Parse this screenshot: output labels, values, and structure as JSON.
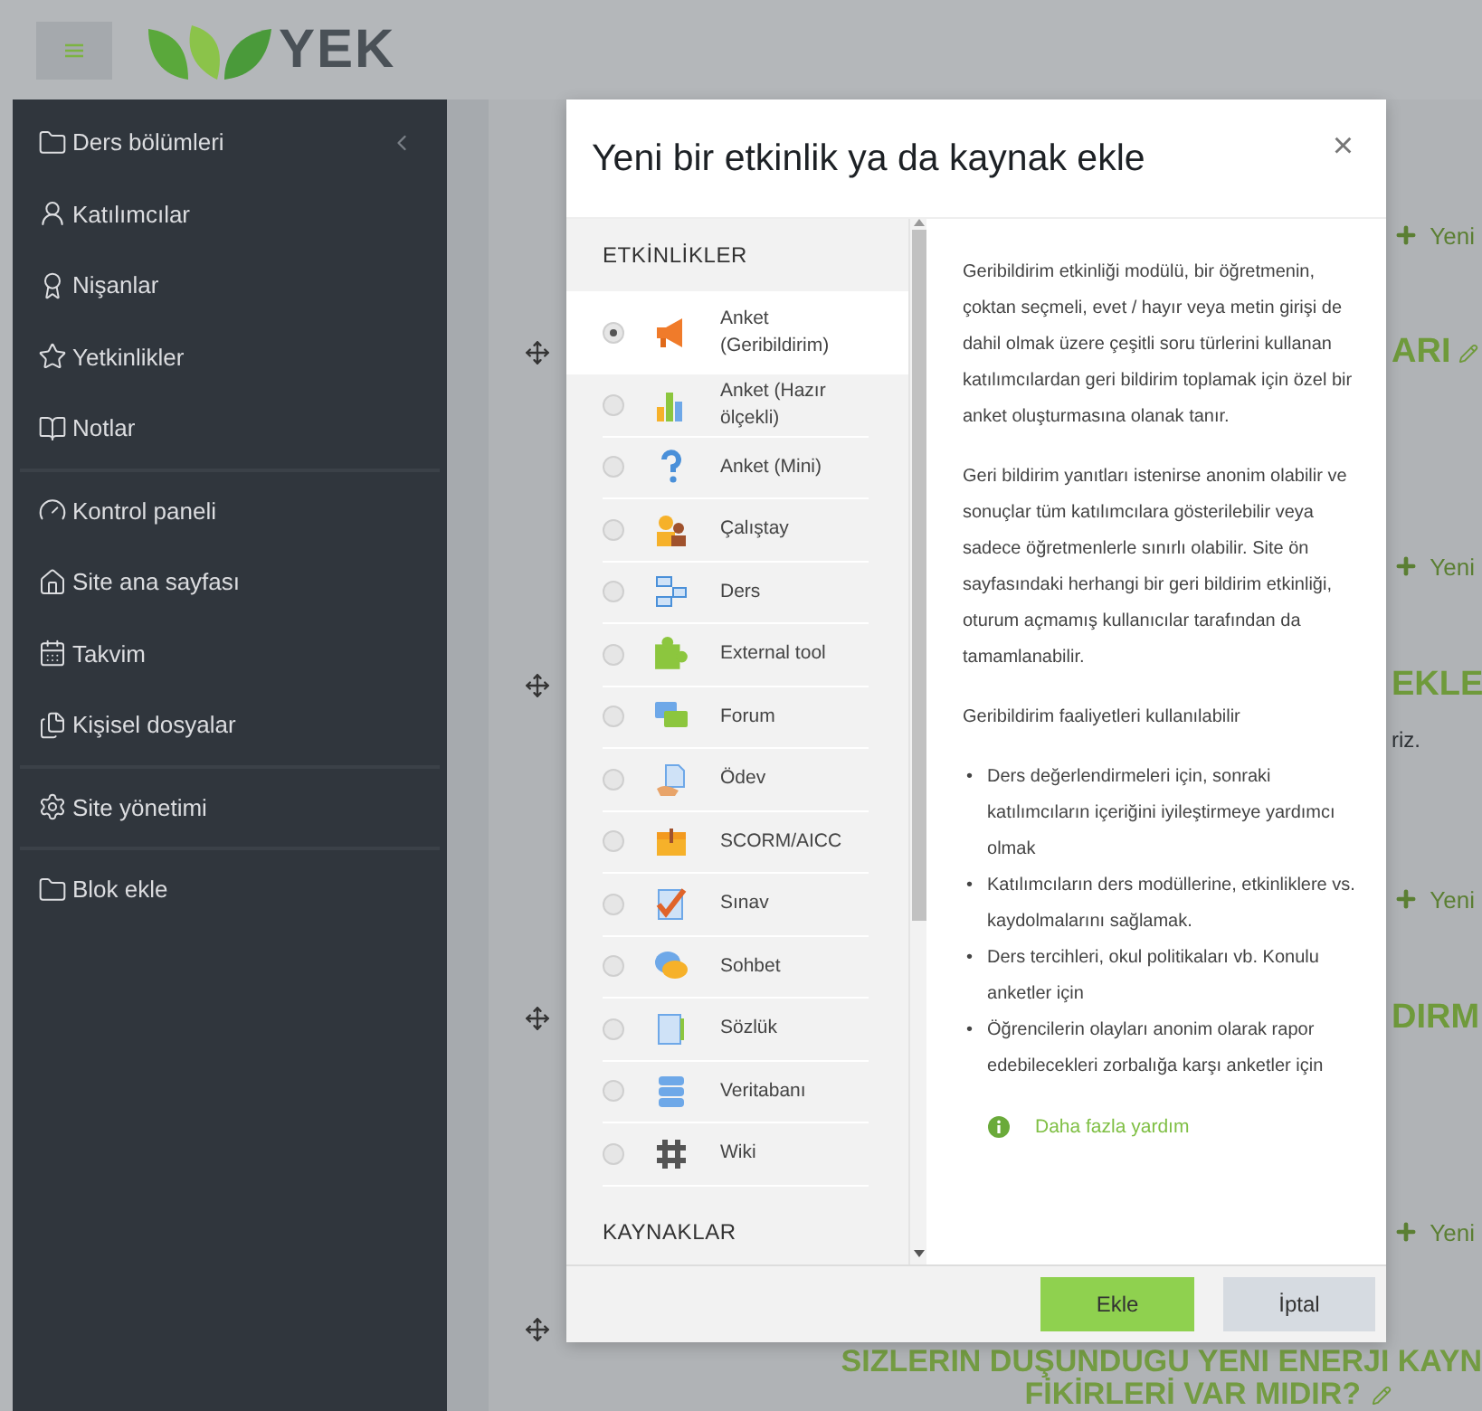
{
  "header": {
    "logo_text": "YEK"
  },
  "sidebar": {
    "groups": [
      [
        {
          "label": "Ders bölümleri",
          "collapsible": true
        },
        {
          "label": "Katılımcılar",
          "collapsible": false
        },
        {
          "label": "Nişanlar",
          "collapsible": false
        },
        {
          "label": "Yetkinlikler",
          "collapsible": false
        },
        {
          "label": "Notlar",
          "collapsible": false
        }
      ],
      [
        {
          "label": "Kontrol paneli",
          "collapsible": false
        },
        {
          "label": "Site ana sayfası",
          "collapsible": false
        },
        {
          "label": "Takvim",
          "collapsible": false
        },
        {
          "label": "Kişisel dosyalar",
          "collapsible": false
        }
      ],
      [
        {
          "label": "Site yönetimi",
          "collapsible": false
        }
      ],
      [
        {
          "label": "Blok ekle",
          "collapsible": false
        }
      ]
    ]
  },
  "course": {
    "sections": [
      {
        "kind": "add",
        "text": "Yeni"
      },
      {
        "kind": "heading",
        "text": "ARI",
        "editable": true
      },
      {
        "kind": "add",
        "text": "Yeni"
      },
      {
        "kind": "heading",
        "text": "EKLE"
      },
      {
        "kind": "text",
        "text": "riz."
      },
      {
        "kind": "add",
        "text": "Yeni"
      },
      {
        "kind": "heading",
        "text": "DIRM"
      },
      {
        "kind": "add",
        "text": "Yeni"
      },
      {
        "kind": "title",
        "lines": [
          "SIZLERIN DUŞUNDUGU YENI ENERJI KAYN",
          "FİKİRLERİ VAR MIDIR?"
        ]
      }
    ]
  },
  "dialog": {
    "title": "Yeni bir etkinlik ya da kaynak ekle",
    "close": "×",
    "activities_heading": "ETKİNLİKLER",
    "activities": [
      {
        "label": "Anket (Geribildirim)",
        "selected": true
      },
      {
        "label": "Anket (Hazır ölçekli)",
        "selected": false
      },
      {
        "label": "Anket (Mini)",
        "selected": false
      },
      {
        "label": "Çalıştay",
        "selected": false
      },
      {
        "label": "Ders",
        "selected": false
      },
      {
        "label": "External tool",
        "selected": false
      },
      {
        "label": "Forum",
        "selected": false
      },
      {
        "label": "Ödev",
        "selected": false
      },
      {
        "label": "SCORM/AICC",
        "selected": false
      },
      {
        "label": "Sınav",
        "selected": false
      },
      {
        "label": "Sohbet",
        "selected": false
      },
      {
        "label": "Sözlük",
        "selected": false
      },
      {
        "label": "Veritabanı",
        "selected": false
      },
      {
        "label": "Wiki",
        "selected": false
      }
    ],
    "resources_heading": "KAYNAKLAR",
    "description": {
      "paragraphs": [
        "Geribildirim etkinliği modülü, bir öğretmenin, çoktan seçmeli, evet / hayır veya metin girişi de dahil olmak üzere çeşitli soru türlerini kullanan katılımcılardan geri bildirim toplamak için özel bir anket oluşturmasına olanak tanır.",
        "Geri bildirim yanıtları istenirse anonim olabilir ve sonuçlar tüm katılımcılara gösterilebilir veya sadece öğretmenlerle sınırlı olabilir. Site ön sayfasındaki herhangi bir geri bildirim etkinliği, oturum açmamış kullanıcılar tarafından da tamamlanabilir.",
        "Geribildirim faaliyetleri kullanılabilir"
      ],
      "bullet_marker": "•",
      "bullets": [
        "Ders değerlendirmeleri için, sonraki katılımcıların içeriğini iyileştirmeye yardımcı olmak",
        "Katılımcıların ders modüllerine, etkinliklere vs. kaydolmalarını sağlamak.",
        "Ders tercihleri, okul politikaları vb. Konulu anketler için",
        "Öğrencilerin olayları anonim olarak rapor edebilecekleri zorbalığa karşı anketler için"
      ],
      "help_link": "Daha fazla yardım"
    },
    "buttons": {
      "add": "Ekle",
      "cancel": "İptal"
    }
  }
}
